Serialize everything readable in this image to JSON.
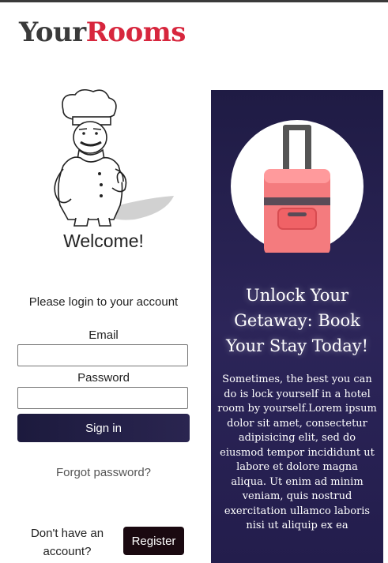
{
  "brand": {
    "part1": "Your",
    "part2": "Rooms",
    "color_primary": "#3a3a3a",
    "color_accent": "#d7263d"
  },
  "login": {
    "illustration": "chef-icon",
    "welcome": "Welcome!",
    "prompt": "Please login to your account",
    "email_label": "Email",
    "email_value": "",
    "email_placeholder": "",
    "password_label": "Password",
    "password_value": "",
    "password_placeholder": "",
    "signin_label": "Sign in",
    "forgot_label": "Forgot password?",
    "no_account_line1": "Don't have an",
    "no_account_line2": "account?",
    "register_label": "Register"
  },
  "promo": {
    "illustration": "suitcase-icon",
    "headline_line1": "Unlock Your",
    "headline_line2": "Getaway: Book",
    "headline_line3": "Your Stay Today!",
    "body": "Sometimes, the best you can do is lock yourself in a hotel room by yourself.Lorem ipsum dolor sit amet, consectetur adipisicing elit, sed do eiusmod tempor incididunt ut labore et dolore magna aliqua. Ut enim ad minim veniam, quis nostrud exercitation ullamco laboris nisi ut aliquip ex ea",
    "background": "#231d4c"
  }
}
